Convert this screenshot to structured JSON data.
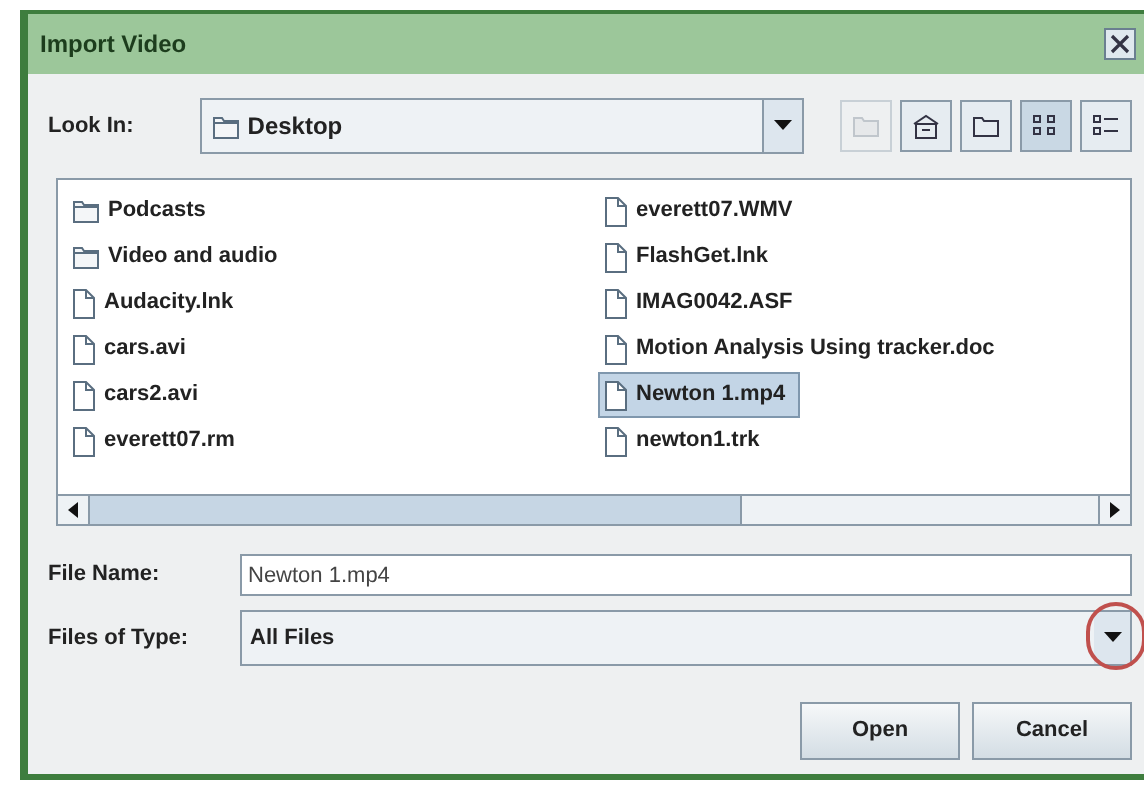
{
  "window": {
    "title": "Import Video"
  },
  "look_in": {
    "label": "Look In:",
    "value": "Desktop"
  },
  "files": [
    {
      "name": "Podcasts",
      "kind": "folder",
      "selected": false
    },
    {
      "name": "Video and audio",
      "kind": "folder",
      "selected": false
    },
    {
      "name": "Audacity.lnk",
      "kind": "file",
      "selected": false
    },
    {
      "name": "cars.avi",
      "kind": "file",
      "selected": false
    },
    {
      "name": "cars2.avi",
      "kind": "file",
      "selected": false
    },
    {
      "name": "everett07.rm",
      "kind": "file",
      "selected": false
    },
    {
      "name": "everett07.WMV",
      "kind": "file",
      "selected": false
    },
    {
      "name": "FlashGet.lnk",
      "kind": "file",
      "selected": false
    },
    {
      "name": "IMAG0042.ASF",
      "kind": "file",
      "selected": false
    },
    {
      "name": "Motion Analysis Using tracker.doc",
      "kind": "file",
      "selected": false
    },
    {
      "name": "Newton 1.mp4",
      "kind": "file",
      "selected": true
    },
    {
      "name": "newton1.trk",
      "kind": "file",
      "selected": false
    }
  ],
  "file_name": {
    "label": "File Name:",
    "value": "Newton 1.mp4"
  },
  "files_of_type": {
    "label": "Files of Type:",
    "value": "All Files"
  },
  "buttons": [
    "Open",
    "Cancel"
  ]
}
